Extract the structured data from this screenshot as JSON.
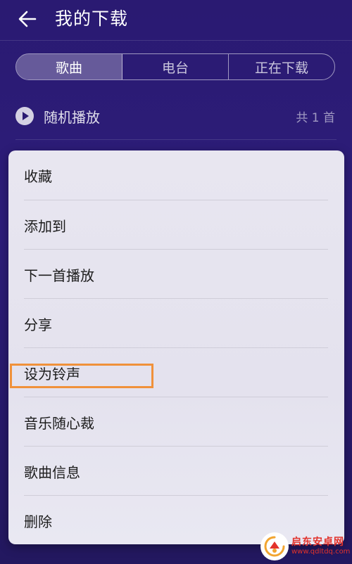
{
  "header": {
    "title": "我的下载",
    "back_icon": "arrow-left-icon"
  },
  "tabs": [
    {
      "label": "歌曲",
      "active": true
    },
    {
      "label": "电台",
      "active": false
    },
    {
      "label": "正在下载",
      "active": false
    }
  ],
  "shuffle": {
    "label": "随机播放",
    "count": "共 1 首",
    "icon": "play-circle-icon"
  },
  "menu": {
    "items": [
      {
        "label": "收藏"
      },
      {
        "label": "添加到"
      },
      {
        "label": "下一首播放"
      },
      {
        "label": "分享"
      },
      {
        "label": "设为铃声",
        "highlighted": true
      },
      {
        "label": "音乐随心裁"
      },
      {
        "label": "歌曲信息"
      },
      {
        "label": "删除"
      }
    ]
  },
  "watermark": {
    "title": "启东安卓网",
    "url": "www.qdltdq.com"
  },
  "colors": {
    "background": "#2a1a72",
    "menu_background": "#e8e6f0",
    "highlight": "#f0913a",
    "watermark": "#e2322b"
  }
}
